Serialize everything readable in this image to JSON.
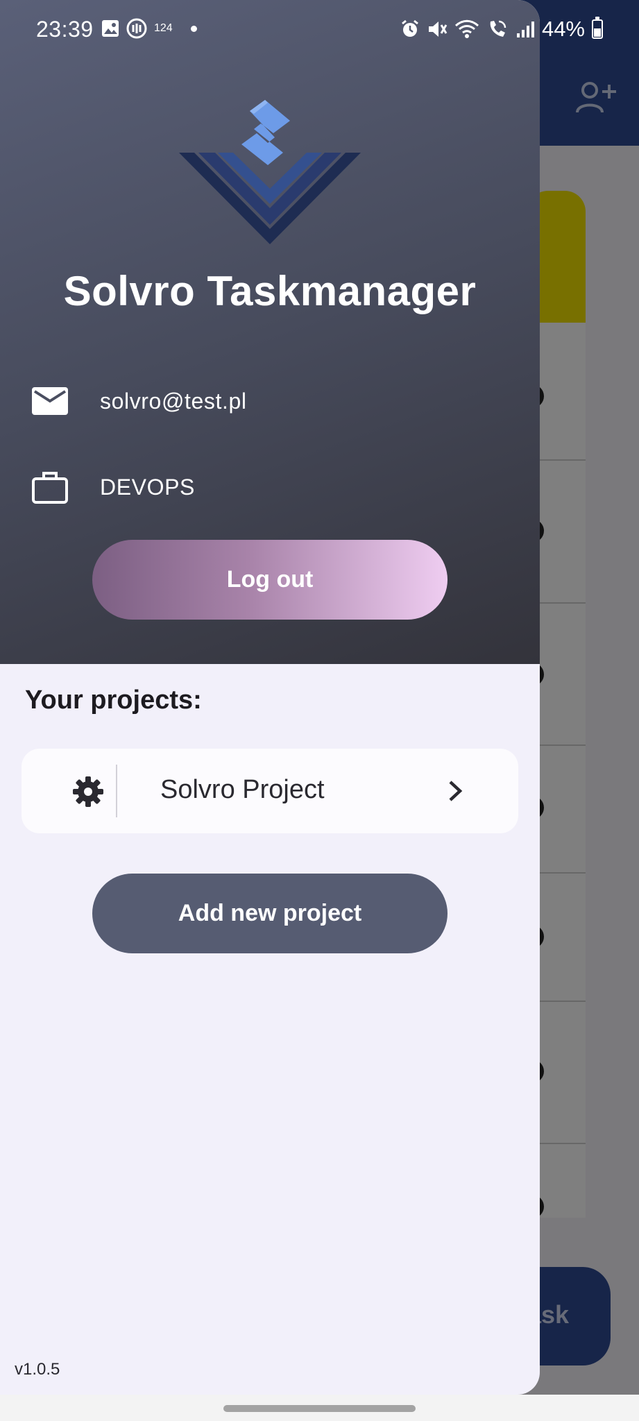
{
  "status_bar": {
    "time": "23:39",
    "notification_count": "124",
    "battery": "44%"
  },
  "background": {
    "fab_label": "ask"
  },
  "drawer": {
    "app_title": "Solvro Taskmanager",
    "email": "solvro@test.pl",
    "role": "DEVOPS",
    "logout_label": "Log out",
    "projects_heading": "Your projects:",
    "projects": [
      {
        "name": "Solvro Project"
      }
    ],
    "add_project_label": "Add new project",
    "version": "v1.0.5"
  },
  "colors": {
    "header_gradient_start": "#5a6078",
    "header_gradient_end": "#33333b",
    "logo_light": "#6d9be8",
    "logo_dark": "#1e2c52",
    "logout_gradient_start": "#7c5f83",
    "logout_gradient_end": "#efcdf1",
    "add_project_button": "#565c72",
    "drawer_background": "#f2f0fa",
    "background_appbar": "#2e4a93",
    "background_card": "#f0e100"
  },
  "icons": {
    "email": "mail-icon",
    "role": "briefcase-icon",
    "project_settings": "gear-icon",
    "project_open": "chevron-right-icon",
    "background_action": "add-person-icon"
  }
}
